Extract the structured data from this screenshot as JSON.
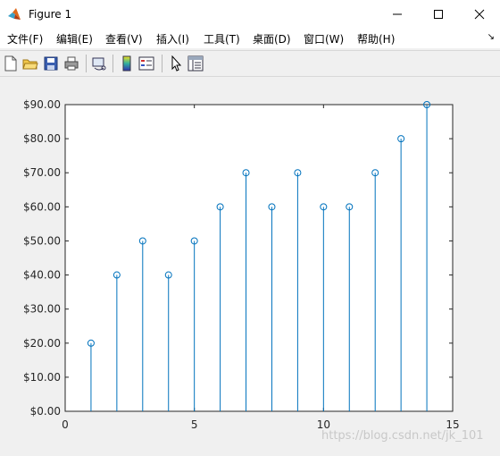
{
  "window": {
    "title": "Figure 1",
    "minimize_glyph": "—",
    "maximize_glyph": "☐",
    "close_glyph": "✕"
  },
  "menu": {
    "items": [
      "文件(F)",
      "编辑(E)",
      "查看(V)",
      "插入(I)",
      "工具(T)",
      "桌面(D)",
      "窗口(W)",
      "帮助(H)"
    ],
    "corner_glyph": "↘"
  },
  "toolbar": {
    "icons": [
      "new-figure-icon",
      "open-file-icon",
      "save-icon",
      "print-icon",
      "link-plot-icon",
      "insert-colorbar-icon",
      "insert-legend-icon",
      "edit-plot-pointer-icon",
      "property-editor-icon"
    ]
  },
  "colors": {
    "stem": "#0072bd",
    "axes_bg": "#ffffff",
    "figure_bg": "#f0f0f0"
  },
  "watermark": "https://blog.csdn.net/jk_101",
  "chart_data": {
    "type": "stem",
    "x": [
      1,
      2,
      3,
      4,
      5,
      6,
      7,
      8,
      9,
      10,
      11,
      12,
      13,
      14
    ],
    "values": [
      20,
      40,
      50,
      40,
      50,
      60,
      70,
      60,
      70,
      60,
      60,
      70,
      80,
      90
    ],
    "marker": "open-circle",
    "xlim": [
      0,
      15
    ],
    "ylim": [
      0,
      90
    ],
    "xticks": [
      0,
      5,
      10,
      15
    ],
    "xtick_labels": [
      "0",
      "5",
      "10",
      "15"
    ],
    "yticks": [
      0,
      10,
      20,
      30,
      40,
      50,
      60,
      70,
      80,
      90
    ],
    "ytick_labels": [
      "$0.00",
      "$10.00",
      "$20.00",
      "$30.00",
      "$40.00",
      "$50.00",
      "$60.00",
      "$70.00",
      "$80.00",
      "$90.00"
    ],
    "grid": false,
    "title": "",
    "xlabel": "",
    "ylabel": ""
  }
}
